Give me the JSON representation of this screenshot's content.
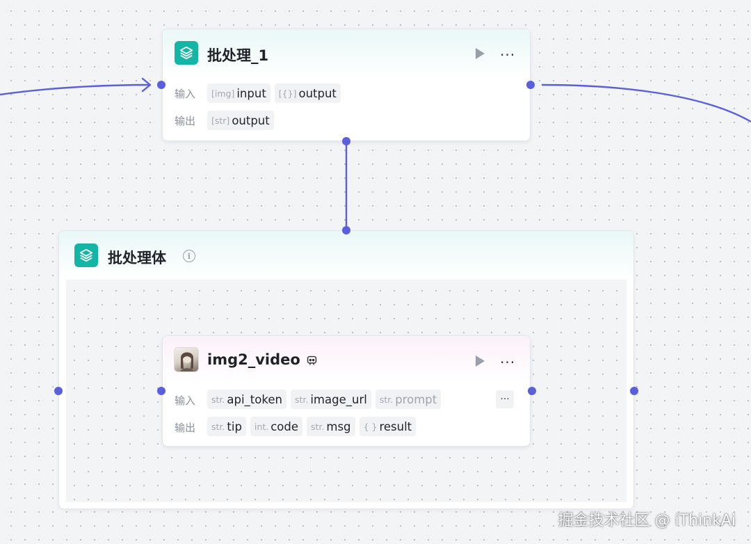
{
  "batch_node": {
    "title": "批处理_1",
    "input_label": "输入",
    "output_label": "输出",
    "inputs": [
      {
        "type": "[img]",
        "name": "input"
      },
      {
        "type": "[{}]",
        "name": "output"
      }
    ],
    "outputs": [
      {
        "type": "[str]",
        "name": "output"
      }
    ]
  },
  "batch_body": {
    "title": "批处理体"
  },
  "video_node": {
    "title": "img2_video",
    "input_label": "输入",
    "output_label": "输出",
    "inputs": [
      {
        "type": "str.",
        "name": "api_token"
      },
      {
        "type": "str.",
        "name": "image_url"
      },
      {
        "type": "str.",
        "name": "prompt"
      }
    ],
    "more_inputs": "···",
    "outputs": [
      {
        "type": "str.",
        "name": "tip"
      },
      {
        "type": "int.",
        "name": "code"
      },
      {
        "type": "str.",
        "name": "msg"
      },
      {
        "type": "{ }",
        "name": "result"
      }
    ]
  },
  "watermark": "掘金技术社区 @ iThinkAi",
  "colors": {
    "edge": "#5a5fdc",
    "node_icon": "#13b5a5"
  },
  "icons": {
    "node_icon": "layers-icon",
    "run": "play-icon",
    "more": "more-dots-icon",
    "info": "info-icon",
    "plugin": "plugin-icon"
  }
}
